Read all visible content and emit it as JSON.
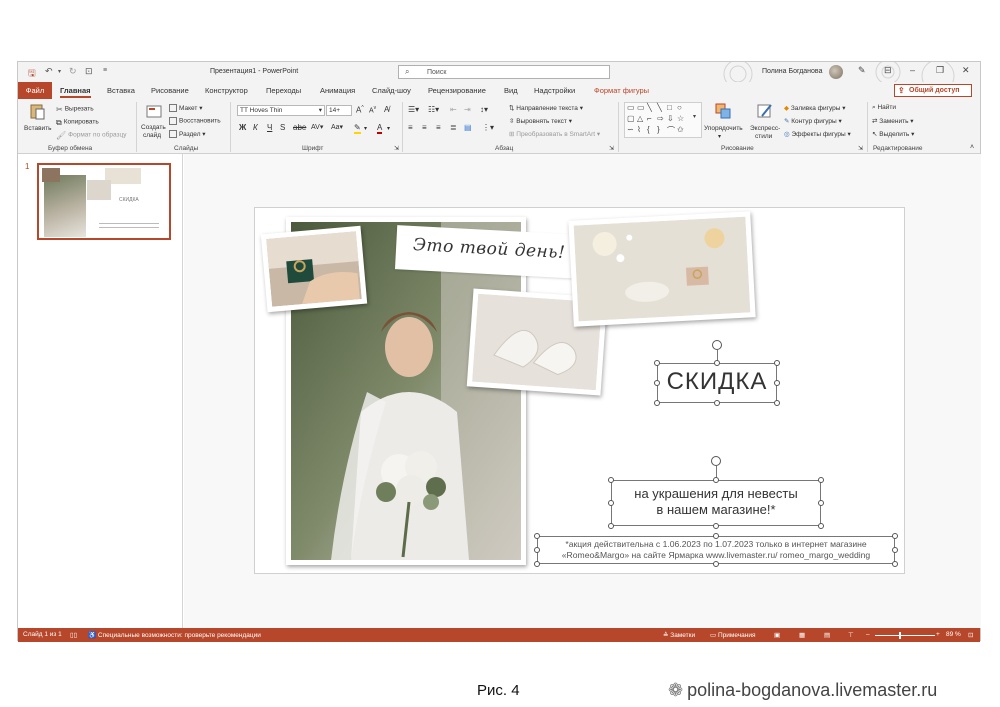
{
  "app": {
    "doc_title": "Презентация1 - PowerPoint",
    "search_placeholder": "Поиск",
    "user_name": "Полина Богданова"
  },
  "tabs": {
    "file": "Файл",
    "items": [
      "Главная",
      "Вставка",
      "Рисование",
      "Конструктор",
      "Переходы",
      "Анимация",
      "Слайд-шоу",
      "Рецензирование",
      "Вид",
      "Надстройки",
      "Формат фигуры"
    ],
    "share": "Общий доступ"
  },
  "ribbon": {
    "clipboard": {
      "paste": "Вставить",
      "cut": "Вырезать",
      "copy": "Копировать",
      "format_painter": "Формат по образцу",
      "label": "Буфер обмена"
    },
    "slides": {
      "new_slide_line1": "Создать",
      "new_slide_line2": "слайд",
      "layout": "Макет",
      "reset": "Восстановить",
      "section": "Раздел",
      "label": "Слайды"
    },
    "font": {
      "font_name": "TT Hoves Thin",
      "font_size": "14+",
      "label": "Шрифт"
    },
    "paragraph": {
      "text_direction": "Направление текста",
      "align_text": "Выровнять текст",
      "smartart": "Преобразовать в SmartArt",
      "label": "Абзац"
    },
    "drawing": {
      "arrange": "Упорядочить",
      "quick_styles_line1": "Экспресс-",
      "quick_styles_line2": "стили",
      "fill": "Заливка фигуры",
      "outline": "Контур фигуры",
      "effects": "Эффекты фигуры",
      "label": "Рисование"
    },
    "editing": {
      "find": "Найти",
      "replace": "Заменить",
      "select": "Выделить",
      "label": "Редактирование"
    }
  },
  "slide_panel": {
    "slide_number": "1"
  },
  "slide": {
    "title": "Это твой день!",
    "headline": "СКИДКА",
    "subtext_line1": "на украшения для невесты",
    "subtext_line2": "в нашем магазине!*",
    "fine_line1": "*акция действительна с 1.06.2023 по 1.07.2023 только в интернет магазине",
    "fine_line2": "«Romeo&Margo» на сайте Ярмарка www.livemaster.ru/ romeo_margo_wedding"
  },
  "statusbar": {
    "slide_info": "Слайд 1 из 1",
    "accessibility": "Специальные возможности: проверьте рекомендации",
    "notes": "Заметки",
    "comments": "Примечания",
    "zoom": "89 %"
  },
  "caption": "Рис. 4",
  "watermark": "polina-bogdanova.livemaster.ru",
  "colors": {
    "accent": "#b7472a",
    "ribbon_bg": "#f3f3f3"
  }
}
